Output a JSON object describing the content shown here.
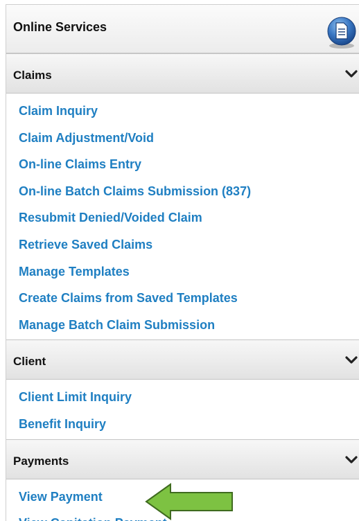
{
  "panel": {
    "title": "Online Services",
    "icon": "document-icon"
  },
  "sections": {
    "claims": {
      "title": "Claims",
      "links": [
        "Claim Inquiry",
        "Claim Adjustment/Void",
        "On-line Claims Entry",
        "On-line Batch Claims Submission (837)",
        "Resubmit Denied/Voided Claim",
        "Retrieve Saved Claims",
        "Manage Templates",
        "Create Claims from Saved Templates",
        "Manage Batch Claim Submission"
      ]
    },
    "client": {
      "title": "Client",
      "links": [
        "Client Limit Inquiry",
        "Benefit Inquiry"
      ]
    },
    "payments": {
      "title": "Payments",
      "links": [
        "View Payment",
        "View Capitation Payment"
      ]
    }
  },
  "annotation": {
    "icon": "green-left-arrow-icon",
    "color": "#7dc242",
    "points_to": "View Payment"
  },
  "colors": {
    "link": "#1f7fc2",
    "header_text": "#111111"
  }
}
